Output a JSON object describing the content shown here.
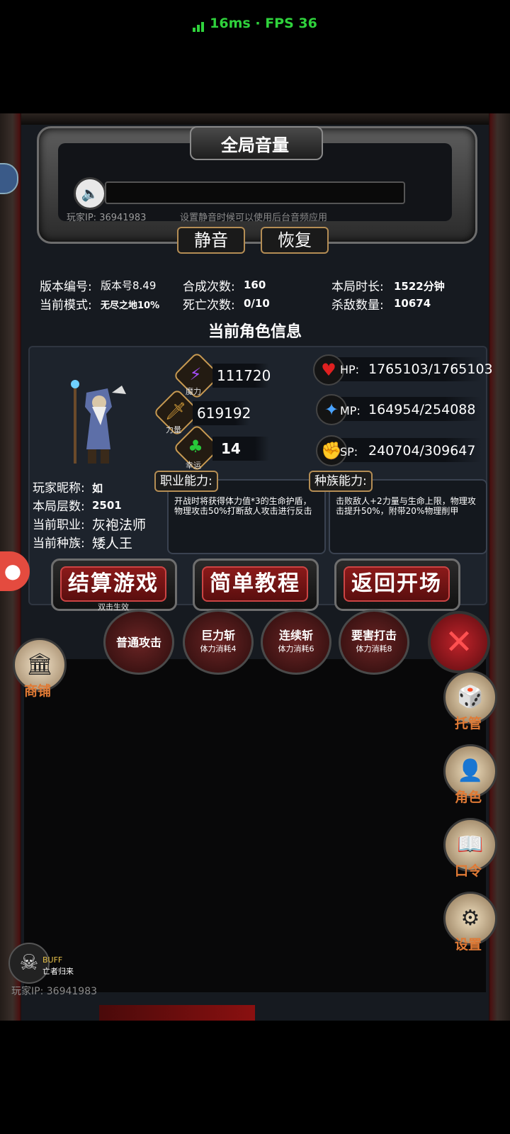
{
  "status_bar": {
    "ping": "16ms",
    "sep": "·",
    "fps": "FPS 36"
  },
  "volume_panel": {
    "title": "全局音量",
    "player_ip_label": "玩家IP:",
    "player_ip": "36941983",
    "hint": "设置静音时候可以使用后台音频应用",
    "mute_button": "静音",
    "restore_button": "恢复"
  },
  "game_info": {
    "version_label": "版本编号:",
    "version_value": "版本号8.49",
    "mode_label": "当前模式:",
    "mode_value": "无尽之地10%",
    "synth_label": "合成次数:",
    "synth_value": "160",
    "death_label": "死亡次数:",
    "death_value": "0/10",
    "duration_label": "本局时长:",
    "duration_value": "1522分钟",
    "kills_label": "杀敌数量:",
    "kills_value": "10674"
  },
  "character": {
    "section_title": "当前角色信息",
    "stats": [
      {
        "tag": "魔力",
        "value": "111720",
        "icon": "lightning-icon"
      },
      {
        "tag": "力量",
        "value": "619192",
        "icon": "sword-icon"
      },
      {
        "tag": "幸运",
        "value": "14",
        "icon": "clover-icon"
      }
    ],
    "resources": [
      {
        "label": "HP:",
        "value": "1765103/1765103",
        "icon": "heart-icon"
      },
      {
        "label": "MP:",
        "value": "164954/254088",
        "icon": "magic-icon"
      },
      {
        "label": "SP:",
        "value": "240704/309647",
        "icon": "stamina-icon"
      }
    ],
    "nickname_label": "玩家昵称:",
    "nickname": "如",
    "floor_label": "本局层数:",
    "floor": "2501",
    "class_label": "当前职业:",
    "class": "灰袍法师",
    "race_label": "当前种族:",
    "race": "矮人王",
    "class_ability_label": "职业能力:",
    "class_ability_text": "开战时将获得体力值*3的生命护盾，物理攻击50%打断敌人攻击进行反击",
    "race_ability_label": "种族能力:",
    "race_ability_text": "击败敌人+2力量与生命上限，物理攻击提升50%，附带20%物理削甲"
  },
  "actions": {
    "settle": "结算游戏",
    "settle_hint": "双击生效",
    "tutorial": "简单教程",
    "back": "返回开场"
  },
  "skills": [
    {
      "name": "普通攻击",
      "cost": ""
    },
    {
      "name": "巨力斩",
      "cost": "体力消耗4"
    },
    {
      "name": "连续斩",
      "cost": "体力消耗6"
    },
    {
      "name": "要害打击",
      "cost": "体力消耗8"
    }
  ],
  "sidebar": {
    "shop": "商铺",
    "auto": "托管",
    "role": "角色",
    "code": "口令",
    "settings": "设置"
  },
  "buff": {
    "label": "BUFF",
    "name": "亡者归来"
  },
  "footer": {
    "player_ip_label": "玩家IP:",
    "player_ip": "36941983"
  }
}
